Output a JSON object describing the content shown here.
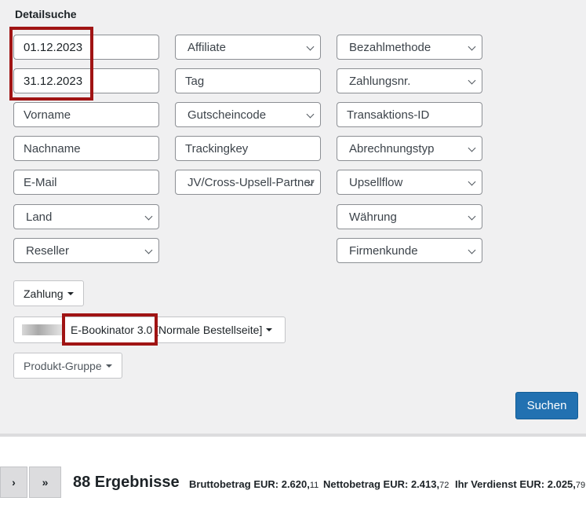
{
  "heading": "Detailsuche",
  "col1": {
    "date_from": "01.12.2023",
    "date_to": "31.12.2023",
    "firstname_placeholder": "Vorname",
    "lastname_placeholder": "Nachname",
    "email_placeholder": "E-Mail",
    "country": "Land",
    "reseller": "Reseller"
  },
  "col2": {
    "affiliate": "Affiliate",
    "tag_placeholder": "Tag",
    "coupon": "Gutscheincode",
    "trackingkey_placeholder": "Trackingkey",
    "jv": "JV/Cross-Upsell-Partner"
  },
  "col3": {
    "payment_method": "Bezahlmethode",
    "payment_no": "Zahlungsnr.",
    "transaction_placeholder": "Transaktions-ID",
    "billing_type": "Abrechnungstyp",
    "upsellflow": "Upsellflow",
    "currency": "Währung",
    "company": "Firmenkunde"
  },
  "buttons": {
    "payment": "Zahlung",
    "product": "E-Bookinator 3.0 [Normale Bestellseite]",
    "product_group": "Produkt-Gruppe",
    "search": "Suchen"
  },
  "pager": {
    "next": "›",
    "last": "»"
  },
  "footer": {
    "results": "88 Ergebnisse",
    "gross_label": "Bruttobetrag EUR: ",
    "gross_main": "2.620,",
    "gross_cents": "11",
    "net_label": "Nettobetrag EUR: ",
    "net_main": "2.413,",
    "net_cents": "72",
    "earn_label": "Ihr Verdienst EUR: ",
    "earn_main": "2.025,",
    "earn_cents": "79"
  },
  "colors": {
    "highlight": "#a01414",
    "primary": "#2271b1"
  }
}
